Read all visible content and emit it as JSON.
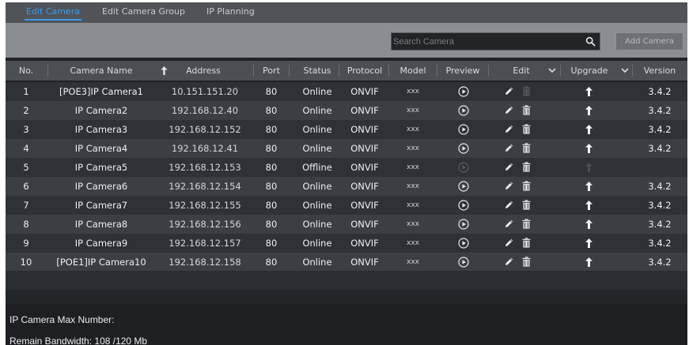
{
  "tabs": [
    {
      "label": "Edit Camera",
      "active": true
    },
    {
      "label": "Edit Camera Group",
      "active": false
    },
    {
      "label": "IP Planning",
      "active": false
    }
  ],
  "toolbar": {
    "search_placeholder": "Search Camera",
    "add_button": "Add Camera"
  },
  "table": {
    "headers": {
      "no": "No.",
      "name": "Camera Name",
      "address": "Address",
      "port": "Port",
      "status": "Status",
      "protocol": "Protocol",
      "model": "Model",
      "preview": "Preview",
      "edit": "Edit",
      "upgrade": "Upgrade",
      "version": "Version"
    },
    "rows": [
      {
        "no": "1",
        "name": "[POE3]IP Camera1",
        "address": "10.151.151.20",
        "port": "80",
        "status": "Online",
        "protocol": "ONVIF",
        "model": "xxx",
        "version": "3.4.2",
        "online": true
      },
      {
        "no": "2",
        "name": "IP Camera2",
        "address": "192.168.12.40",
        "port": "80",
        "status": "Online",
        "protocol": "ONVIF",
        "model": "xxx",
        "version": "3.4.2",
        "online": true
      },
      {
        "no": "3",
        "name": "IP Camera3",
        "address": "192.168.12.152",
        "port": "80",
        "status": "Online",
        "protocol": "ONVIF",
        "model": "xxx",
        "version": "3.4.2",
        "online": true
      },
      {
        "no": "4",
        "name": "IP Camera4",
        "address": "192.168.12.41",
        "port": "80",
        "status": "Online",
        "protocol": "ONVIF",
        "model": "xxx",
        "version": "3.4.2",
        "online": true
      },
      {
        "no": "5",
        "name": "IP Camera5",
        "address": "192.168.12.153",
        "port": "80",
        "status": "Offline",
        "protocol": "ONVIF",
        "model": "xxx",
        "version": "",
        "online": false
      },
      {
        "no": "6",
        "name": "IP Camera6",
        "address": "192.168.12.154",
        "port": "80",
        "status": "Online",
        "protocol": "ONVIF",
        "model": "xxx",
        "version": "3.4.2",
        "online": true
      },
      {
        "no": "7",
        "name": "IP Camera7",
        "address": "192.168.12.155",
        "port": "80",
        "status": "Online",
        "protocol": "ONVIF",
        "model": "xxx",
        "version": "3.4.2",
        "online": true
      },
      {
        "no": "8",
        "name": "IP Camera8",
        "address": "192.168.12.156",
        "port": "80",
        "status": "Online",
        "protocol": "ONVIF",
        "model": "xxx",
        "version": "3.4.2",
        "online": true
      },
      {
        "no": "9",
        "name": "IP Camera9",
        "address": "192.168.12.157",
        "port": "80",
        "status": "Online",
        "protocol": "ONVIF",
        "model": "xxx",
        "version": "3.4.2",
        "online": true
      },
      {
        "no": "10",
        "name": "[POE1]IP Camera10",
        "address": "192.168.12.158",
        "port": "80",
        "status": "Online",
        "protocol": "ONVIF",
        "model": "xxx",
        "version": "3.4.2",
        "online": true
      }
    ]
  },
  "footer": {
    "max_number": "IP Camera Max Number:",
    "bandwidth": "Remain Bandwidth: 108 /120 Mb"
  },
  "icons": {
    "search": "search-icon",
    "sort": "sort-arrow-up-icon",
    "dropdown": "chevron-down-icon",
    "preview": "play-icon",
    "edit": "pencil-icon",
    "delete": "trash-icon",
    "upgrade": "arrow-up-icon"
  },
  "colors": {
    "accent": "#3d9be8",
    "panel": "#1f2124",
    "row_odd": "#2e3135",
    "row_even": "#3b3e42"
  }
}
